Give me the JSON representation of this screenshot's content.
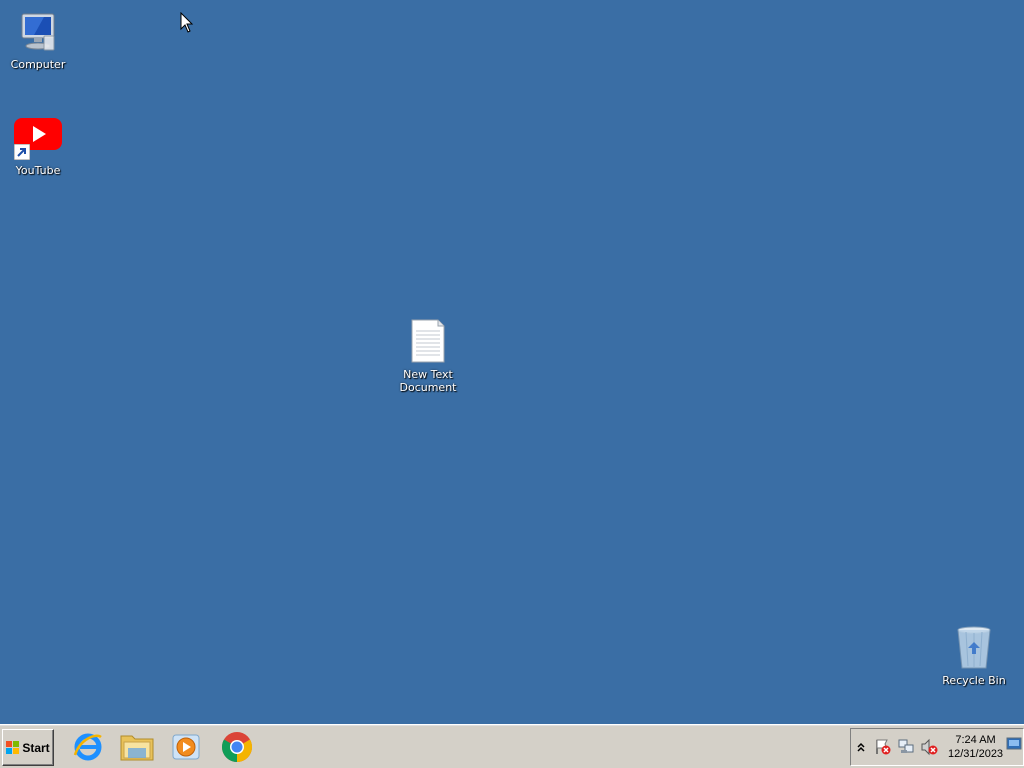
{
  "desktop": {
    "background_color": "#3a6ea5",
    "icons": {
      "computer": {
        "label": "Computer",
        "icon": "computer-icon"
      },
      "youtube": {
        "label": "YouTube",
        "icon": "youtube-icon"
      },
      "text_document": {
        "label": "New Text Document",
        "icon": "text-document-icon"
      },
      "recycle_bin": {
        "label": "Recycle Bin",
        "icon": "recycle-bin-icon"
      }
    }
  },
  "taskbar": {
    "start_label": "Start",
    "pinned": [
      {
        "name": "Internet Explorer",
        "icon": "internet-explorer-icon"
      },
      {
        "name": "Windows Explorer",
        "icon": "folder-icon"
      },
      {
        "name": "Windows Media Player",
        "icon": "media-player-icon"
      },
      {
        "name": "Google Chrome",
        "icon": "chrome-icon"
      }
    ],
    "tray": {
      "time": "7:24 AM",
      "date": "12/31/2023",
      "icons": [
        "action-center-icon",
        "network-icon",
        "volume-muted-icon"
      ]
    }
  }
}
